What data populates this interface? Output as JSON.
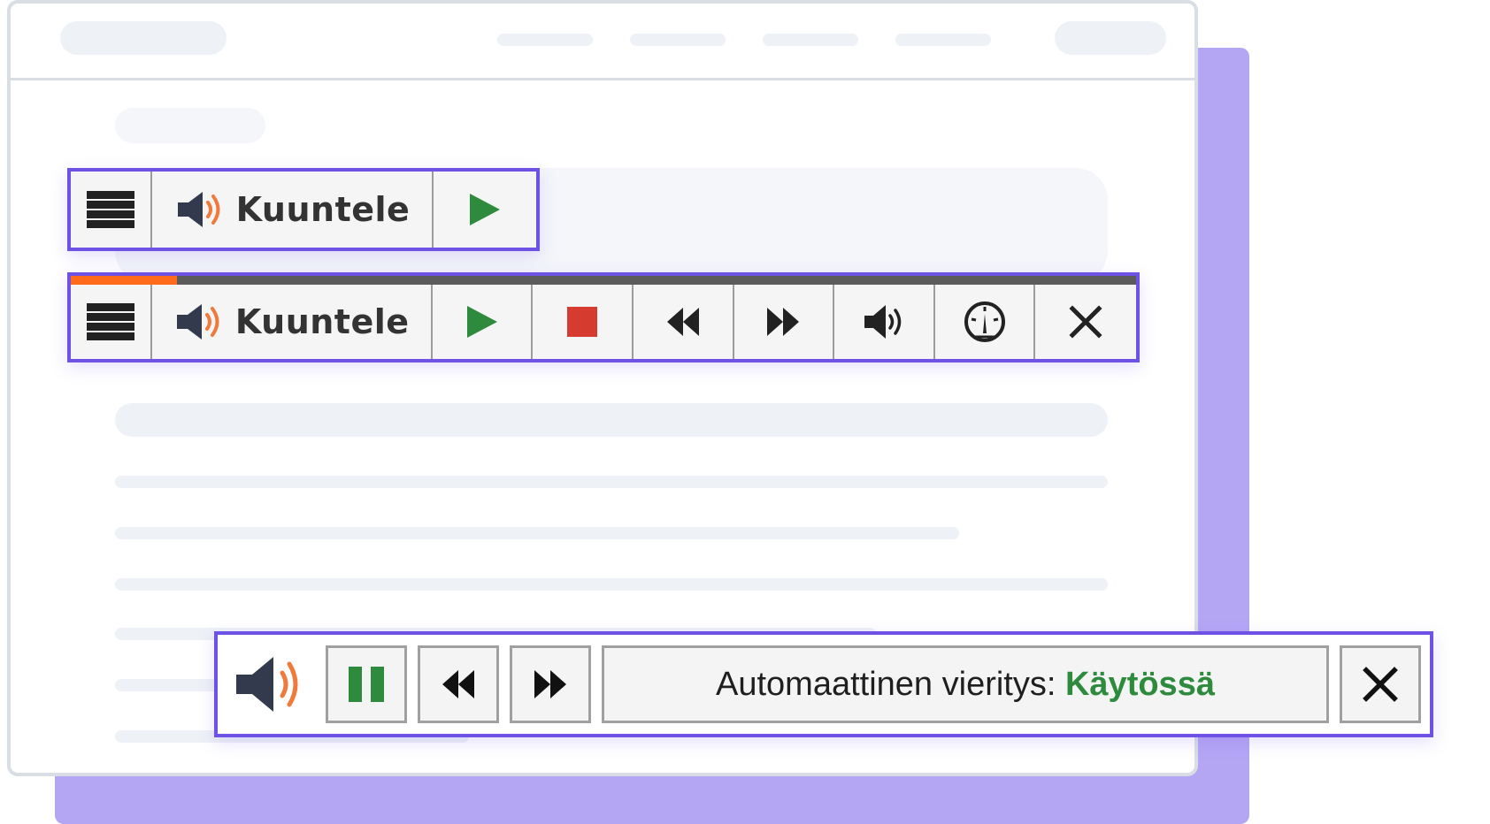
{
  "colors": {
    "accent_border": "#6e52e6",
    "backdrop": "#b5a6f4",
    "play_green": "#2e8b3e",
    "stop_red": "#d63b2f",
    "speaker_orange": "#f07a3a",
    "progress_orange": "#ff6b1a"
  },
  "toolbar_compact": {
    "menu_icon": "hamburger-menu-icon",
    "listen_icon": "speaker-icon",
    "listen_label": "Kuuntele",
    "play_icon": "play-icon"
  },
  "toolbar_expanded": {
    "progress": 0.1,
    "menu_icon": "hamburger-menu-icon",
    "listen_icon": "speaker-icon",
    "listen_label": "Kuuntele",
    "buttons": [
      {
        "name": "play",
        "icon": "play-icon"
      },
      {
        "name": "stop",
        "icon": "stop-icon"
      },
      {
        "name": "rewind",
        "icon": "rewind-icon"
      },
      {
        "name": "forward",
        "icon": "fast-forward-icon"
      },
      {
        "name": "volume",
        "icon": "volume-icon"
      },
      {
        "name": "speed",
        "icon": "speedometer-icon"
      },
      {
        "name": "close",
        "icon": "close-icon"
      }
    ]
  },
  "toolbar_player": {
    "speaker_icon": "speaker-icon",
    "pause_icon": "pause-icon",
    "rewind_icon": "rewind-icon",
    "forward_icon": "fast-forward-icon",
    "autoscroll_label": "Automaattinen vieritys:",
    "autoscroll_value": "Käytössä",
    "close_icon": "close-icon"
  }
}
